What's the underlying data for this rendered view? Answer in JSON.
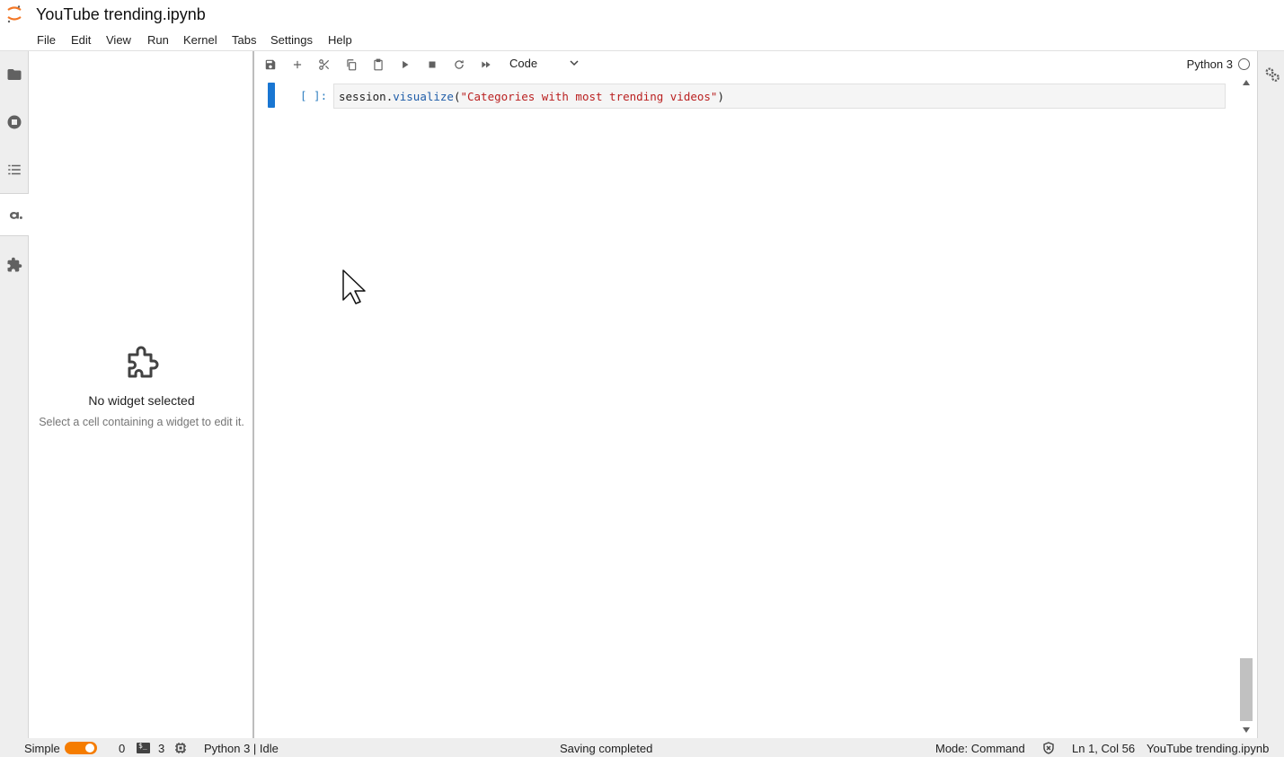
{
  "window": {
    "title": "YouTube trending.ipynb"
  },
  "menu": [
    "File",
    "Edit",
    "View",
    "Run",
    "Kernel",
    "Tabs",
    "Settings",
    "Help"
  ],
  "left_sidebar_icons": [
    "folder-icon",
    "running-icon",
    "toc-icon",
    "widget-inspector-icon",
    "extension-icon"
  ],
  "widget_panel": {
    "title": "No widget selected",
    "description": "Select a cell containing a widget to edit it."
  },
  "toolbar": {
    "buttons": [
      "save-icon",
      "insert-cell-icon",
      "cut-icon",
      "copy-icon",
      "paste-icon",
      "run-icon",
      "stop-icon",
      "restart-icon",
      "fast-forward-icon"
    ],
    "cell_type": "Code",
    "kernel_name": "Python 3"
  },
  "cell": {
    "prompt": "[ ]:",
    "code_object": "session",
    "code_dot": ".",
    "code_method": "visualize",
    "code_open": "(",
    "code_string": "\"Categories with most trending videos\"",
    "code_close": ")"
  },
  "statusbar": {
    "mode_label": "Simple",
    "mode_on": true,
    "kernels_count": "0",
    "terminals_count": "3",
    "kernel_status": "Python 3 | Idle",
    "save_status": "Saving completed",
    "mode": "Mode: Command",
    "cursor_position": "Ln 1, Col 56",
    "file_name": "YouTube trending.ipynb"
  },
  "colors": {
    "accent": "#1976d2",
    "toggle": "#f57c00",
    "string": "#ba2121",
    "prompt": "#307fc1"
  }
}
